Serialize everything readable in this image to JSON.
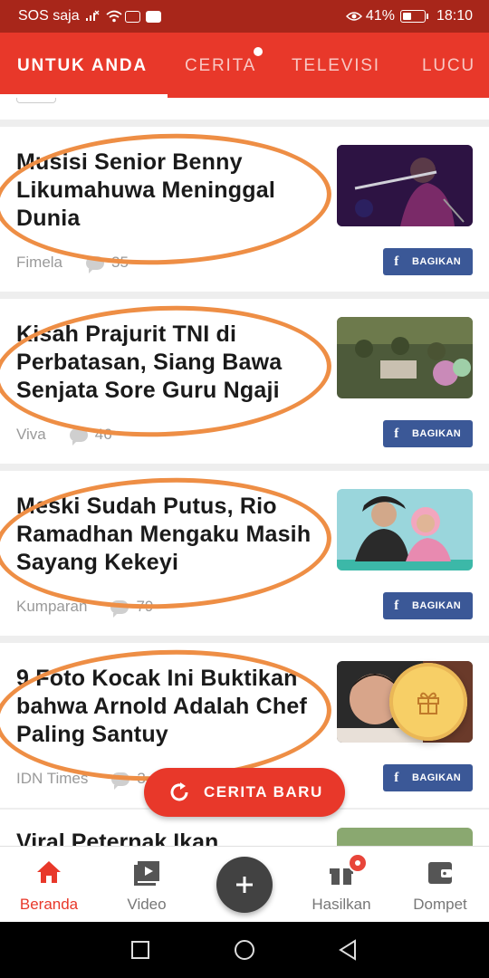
{
  "status_bar": {
    "carrier": "SOS saja",
    "battery": "41%",
    "battery_level": 0.41,
    "time": "18:10"
  },
  "tabs": [
    {
      "label": "UNTUK ANDA",
      "active": true
    },
    {
      "label": "CERITA",
      "active": false,
      "has_dot": true
    },
    {
      "label": "TELEVISI",
      "active": false
    },
    {
      "label": "LUCU",
      "active": false
    }
  ],
  "articles": [
    {
      "title": "Musisi Senior Benny Likumahuwa Meninggal Dunia",
      "source": "Fimela",
      "comments": "35",
      "share_label": "BAGIKAN"
    },
    {
      "title": "Kisah Prajurit TNI di Perbatasan, Siang Bawa Senjata Sore Guru Ngaji",
      "source": "Viva",
      "comments": "46",
      "share_label": "BAGIKAN"
    },
    {
      "title": "Meski Sudah Putus, Rio Ramadhan Mengaku Masih Sayang Kekeyi",
      "source": "Kumparan",
      "comments": "79",
      "share_label": "BAGIKAN"
    },
    {
      "title": "9 Foto Kocak Ini Buktikan bahwa Arnold Adalah Chef Paling Santuy",
      "source": "IDN Times",
      "comments": "3",
      "share_label": "BAGIKAN"
    },
    {
      "title": "Viral Peternak Ikan"
    }
  ],
  "new_stories_button": "CERITA BARU",
  "bottom_nav": [
    {
      "label": "Beranda",
      "icon": "home-icon",
      "active": true
    },
    {
      "label": "Video",
      "icon": "video-icon",
      "active": false
    },
    {
      "label": "Hasilkan",
      "icon": "gift-box-icon",
      "active": false
    },
    {
      "label": "Dompet",
      "icon": "wallet-icon",
      "active": false
    }
  ],
  "colors": {
    "brand_red": "#e8382a",
    "status_bar": "#a8261a",
    "facebook_blue": "#3b5897",
    "annotation_orange": "#ee8e45",
    "gift_yellow": "#f7cf66"
  }
}
